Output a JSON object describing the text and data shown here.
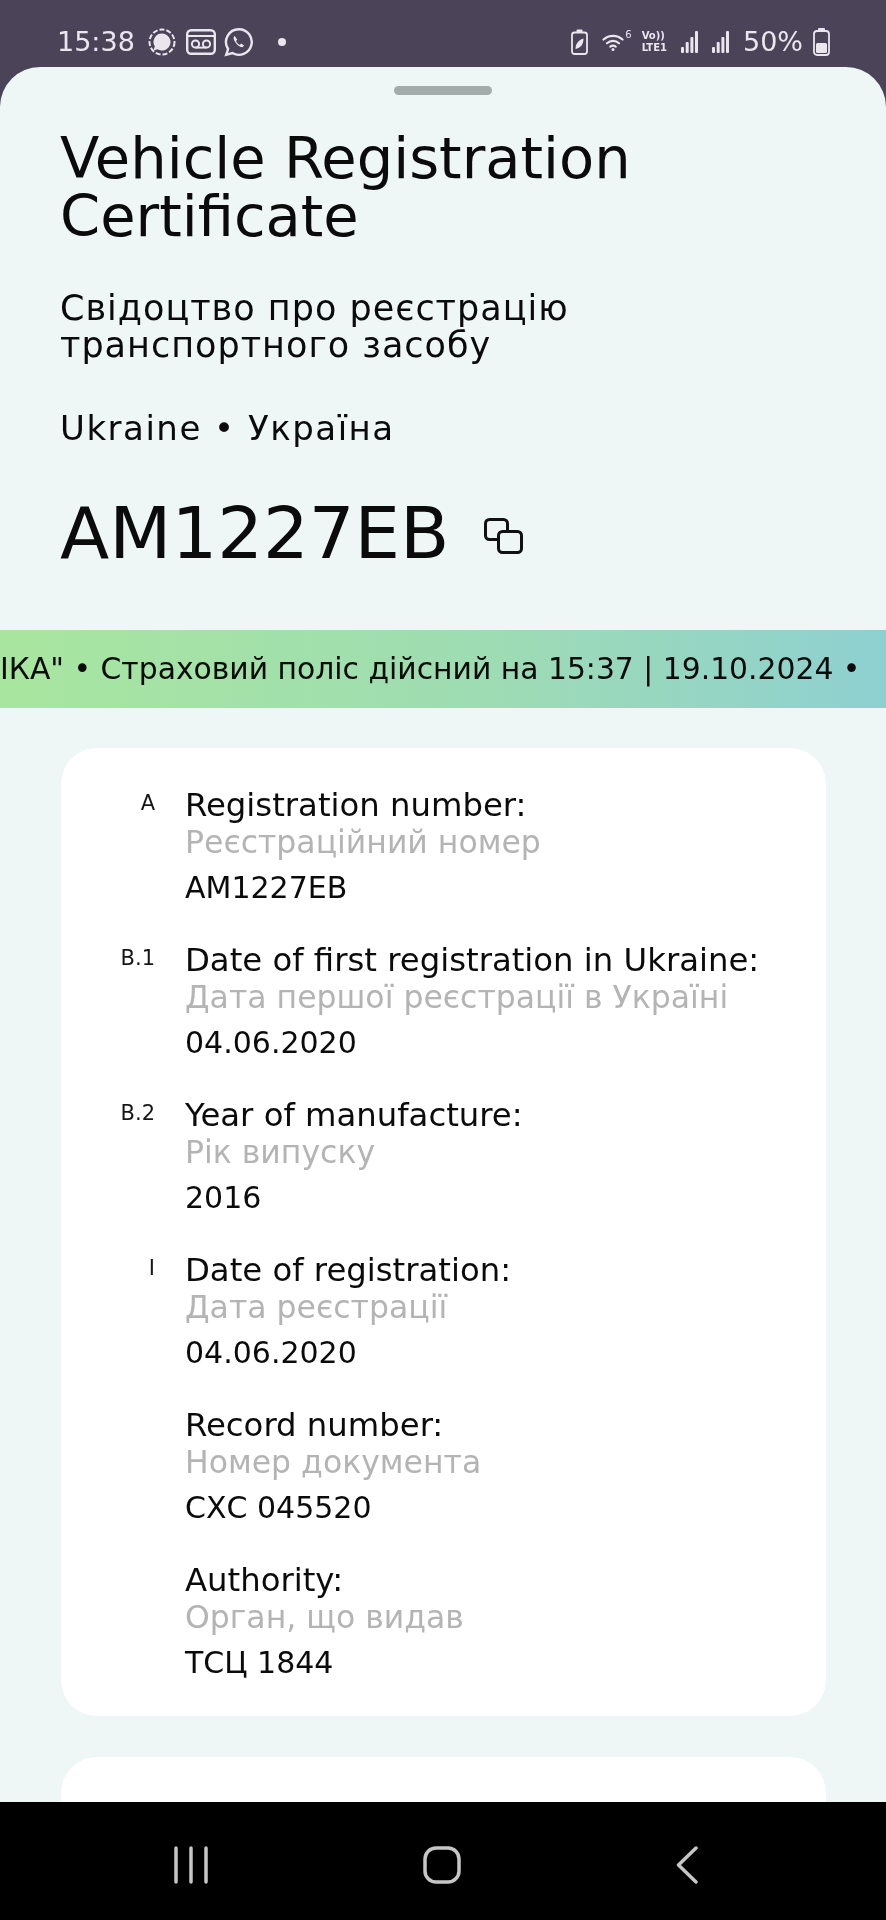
{
  "status_bar": {
    "time": "15:38",
    "wifi_label": "6",
    "network_labels": [
      "Vo))",
      "LTE1"
    ],
    "battery": "50%"
  },
  "header": {
    "title": "Vehicle Registration Certificate",
    "subtitle": "Свідоцтво про реєстрацію транспортного засобу",
    "country": "Ukraine • Україна",
    "plate": "AM1227EB"
  },
  "ticker": {
    "text": "ІКА\" • Страховий поліс дійсний на 15:37 | 19.10.2024 •"
  },
  "fields": [
    {
      "code": "A",
      "label": "Registration number:",
      "label_uk": "Реєстраційний номер",
      "value": "AM1227EB"
    },
    {
      "code": "B.1",
      "label": "Date of first registration in Ukraine:",
      "label_uk": "Дата першої реєстрації в Україні",
      "value": "04.06.2020"
    },
    {
      "code": "B.2",
      "label": "Year of manufacture:",
      "label_uk": "Рік випуску",
      "value": "2016"
    },
    {
      "code": "I",
      "label": "Date of registration:",
      "label_uk": "Дата реєстрації",
      "value": "04.06.2020"
    },
    {
      "label": "Record number:",
      "label_uk": "Номер документа",
      "value": "СХС 045520"
    },
    {
      "label": "Authority:",
      "label_uk": "Орган, що видав",
      "value": "ТСЦ 1844"
    }
  ]
}
